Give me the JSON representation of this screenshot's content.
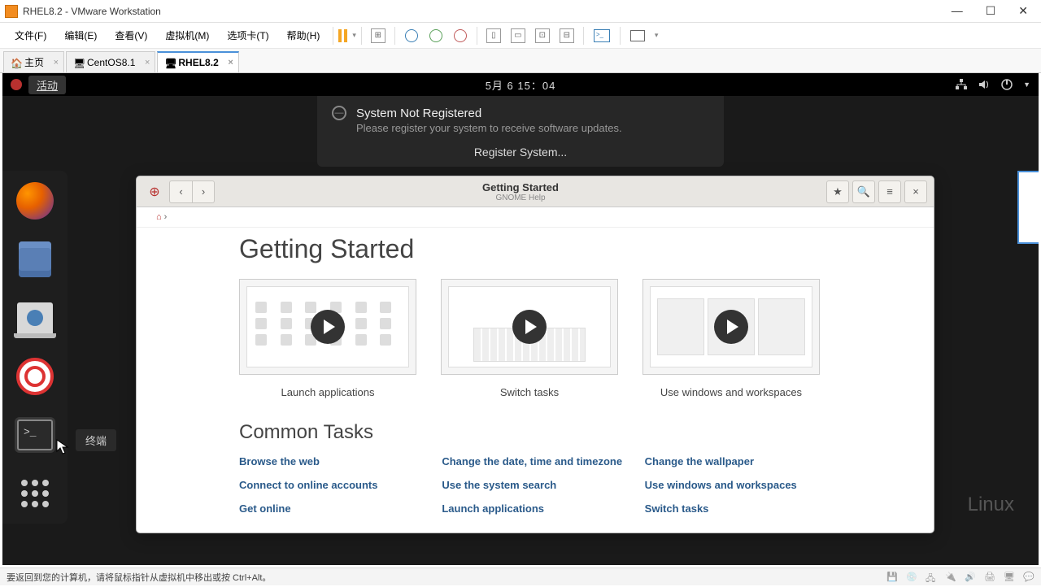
{
  "window": {
    "title": "RHEL8.2 - VMware Workstation"
  },
  "menu": {
    "file": "文件(F)",
    "edit": "编辑(E)",
    "view": "查看(V)",
    "vm": "虚拟机(M)",
    "tabs": "选项卡(T)",
    "help": "帮助(H)"
  },
  "vmtabs": {
    "home": "主页",
    "t1": "CentOS8.1",
    "t2": "RHEL8.2"
  },
  "gnome": {
    "activities": "活动",
    "clock": "5月 6  15：04"
  },
  "notif": {
    "title": "System Not Registered",
    "sub": "Please register your system to receive software updates.",
    "action": "Register System..."
  },
  "dock_tooltip": "终端",
  "help": {
    "title": "Getting Started",
    "subtitle": "GNOME Help",
    "h1": "Getting Started",
    "card1": "Launch applications",
    "card2": "Switch tasks",
    "card3": "Use windows and workspaces",
    "h2": "Common Tasks",
    "col1": {
      "a": "Browse the web",
      "b": "Connect to online accounts",
      "c": "Get online"
    },
    "col2": {
      "a": "Change the date, time and timezone",
      "b": "Use the system search",
      "c": "Launch applications"
    },
    "col3": {
      "a": "Change the wallpaper",
      "b": "Use windows and workspaces",
      "c": "Switch tasks"
    }
  },
  "watermark": "Linux",
  "status": {
    "text": "要返回到您的计算机，请将鼠标指针从虚拟机中移出或按 Ctrl+Alt。"
  }
}
